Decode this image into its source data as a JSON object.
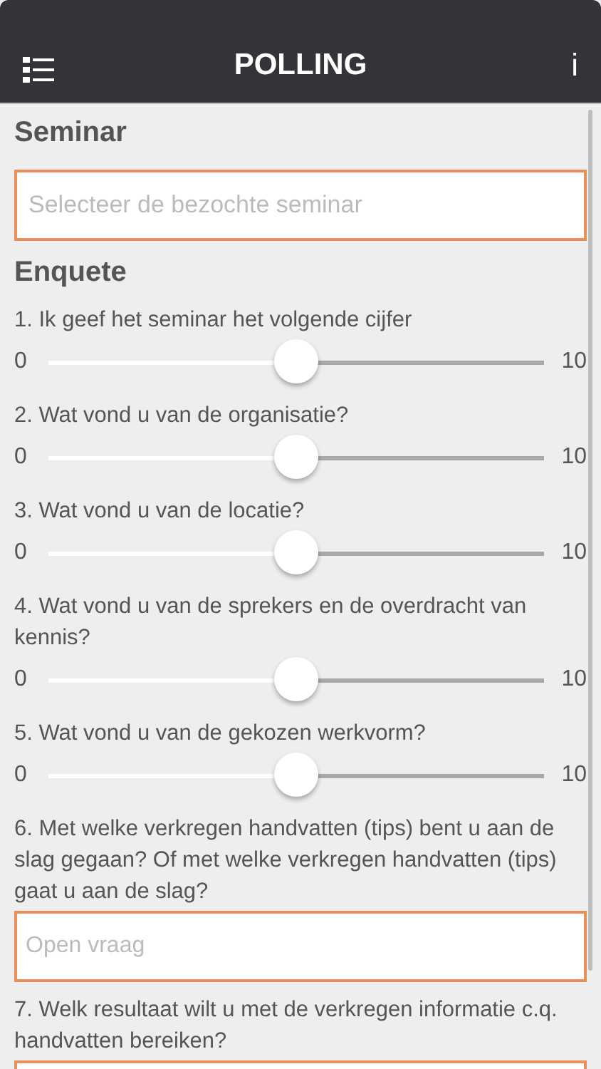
{
  "header": {
    "title": "POLLING",
    "info": "i"
  },
  "seminar": {
    "heading": "Seminar",
    "placeholder": "Selecteer de bezochte seminar"
  },
  "survey": {
    "heading": "Enquete",
    "questions": [
      {
        "kind": "slider",
        "text": "1. Ik geef het seminar het volgende cijfer",
        "min": "0",
        "max": "10",
        "level": 0.5
      },
      {
        "kind": "slider",
        "text": "2. Wat vond u van de organisatie?",
        "min": "0",
        "max": "10",
        "level": 0.5
      },
      {
        "kind": "slider",
        "text": "3. Wat vond u van de locatie?",
        "min": "0",
        "max": "10",
        "level": 0.5
      },
      {
        "kind": "slider",
        "text": "4. Wat vond u van de sprekers en de overdracht van kennis?",
        "min": "0",
        "max": "10",
        "level": 0.5
      },
      {
        "kind": "slider",
        "text": "5. Wat vond u van de gekozen werkvorm?",
        "min": "0",
        "max": "10",
        "level": 0.5
      },
      {
        "kind": "open",
        "text": "6. Met welke verkregen handvatten (tips) bent u aan de slag gegaan? Of met welke verkregen handvatten (tips) gaat u aan de slag?",
        "placeholder": "Open vraag"
      },
      {
        "kind": "open",
        "text": "7. Welk resultaat wilt u met de verkregen informatie c.q. handvatten bereiken?"
      }
    ]
  }
}
